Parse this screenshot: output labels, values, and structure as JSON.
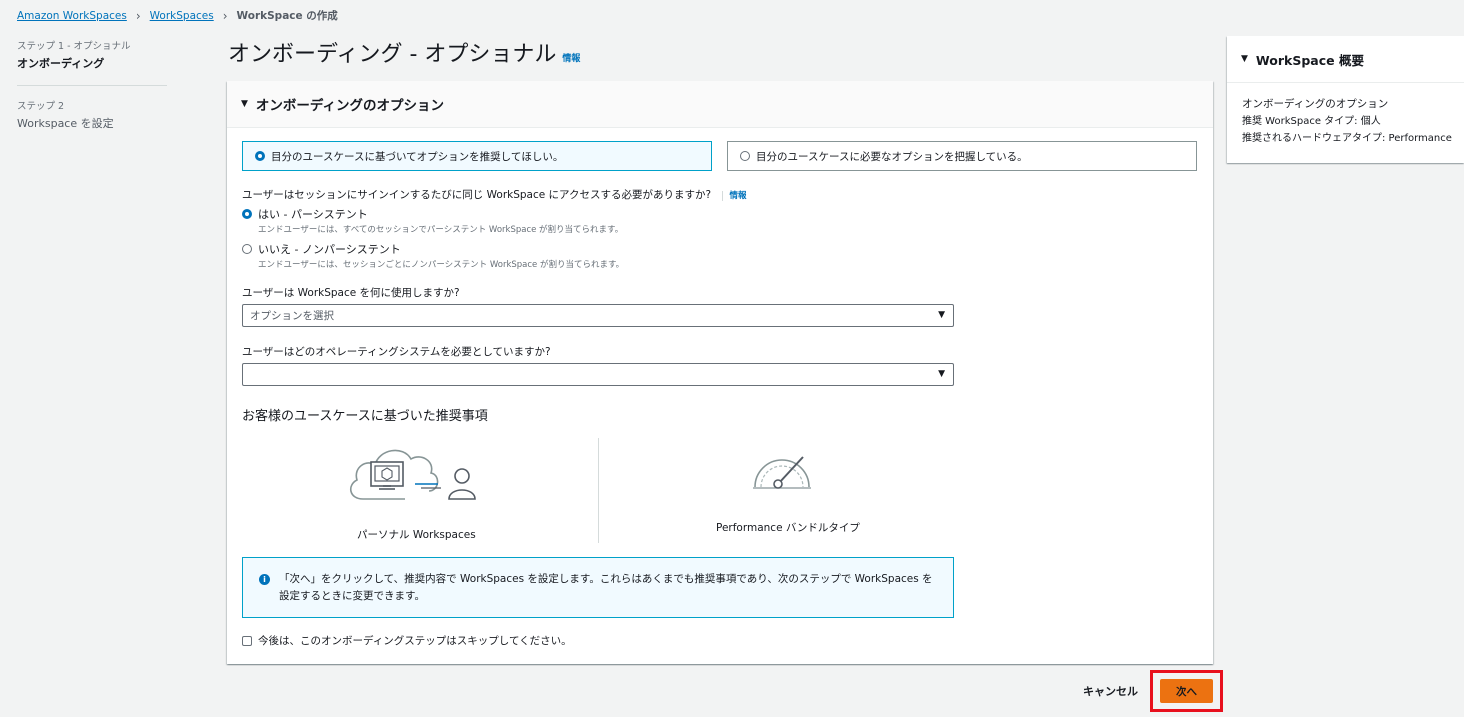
{
  "breadcrumb": {
    "items": [
      "Amazon WorkSpaces",
      "WorkSpaces"
    ],
    "current": "WorkSpace の作成"
  },
  "steps": [
    {
      "sub": "ステップ 1 - オプショナル",
      "title": "オンボーディング"
    },
    {
      "sub": "ステップ 2",
      "title": "Workspace を設定"
    }
  ],
  "page": {
    "title": "オンボーディング - オプショナル",
    "info": "情報"
  },
  "panel": {
    "header": "オンボーディングのオプション",
    "tile_recommend": "目分のユースケースに基づいてオプションを推奨してほしい。",
    "tile_known": "目分のユースケースに必要なオプションを把握している。",
    "q1": "ユーザーはセッションにサインインするたびに同じ WorkSpace にアクセスする必要がありますか?",
    "q1_info": "情報",
    "opt_yes": "はい - パーシステント",
    "opt_yes_desc": "エンドユーザーには、すべてのセッションでパーシステント WorkSpace が割り当てられます。",
    "opt_no": "いいえ - ノンパーシステント",
    "opt_no_desc": "エンドユーザーには、セッションごとにノンパーシステント WorkSpace が割り当てられます。",
    "q2": "ユーザーは WorkSpace を何に使用しますか?",
    "q2_placeholder": "オプションを選択",
    "q3": "ユーザーはどのオペレーティングシステムを必要としていますか?",
    "q3_value": "",
    "reco_title": "お客様のユースケースに基づいた推奨事項",
    "reco_left": "パーソナル Workspaces",
    "reco_right": "Performance バンドルタイプ",
    "alert_text": "「次へ」をクリックして、推奨内容で WorkSpaces を設定します。これらはあくまでも推奨事項であり、次のステップで WorkSpaces を設定するときに変更できます。",
    "skip_label": "今後は、このオンボーディングステップはスキップしてください。"
  },
  "summary": {
    "header": "WorkSpace 概要",
    "line1": "オンボーディングのオプション",
    "line2": "推奨 WorkSpace タイプ: 個人",
    "line3": "推奨されるハードウェアタイプ: Performance"
  },
  "footer": {
    "cancel": "キャンセル",
    "next": "次へ"
  },
  "colors": {
    "accent": "#0073bb",
    "primary_button": "#ec7211",
    "highlight_border": "#e8101d"
  }
}
